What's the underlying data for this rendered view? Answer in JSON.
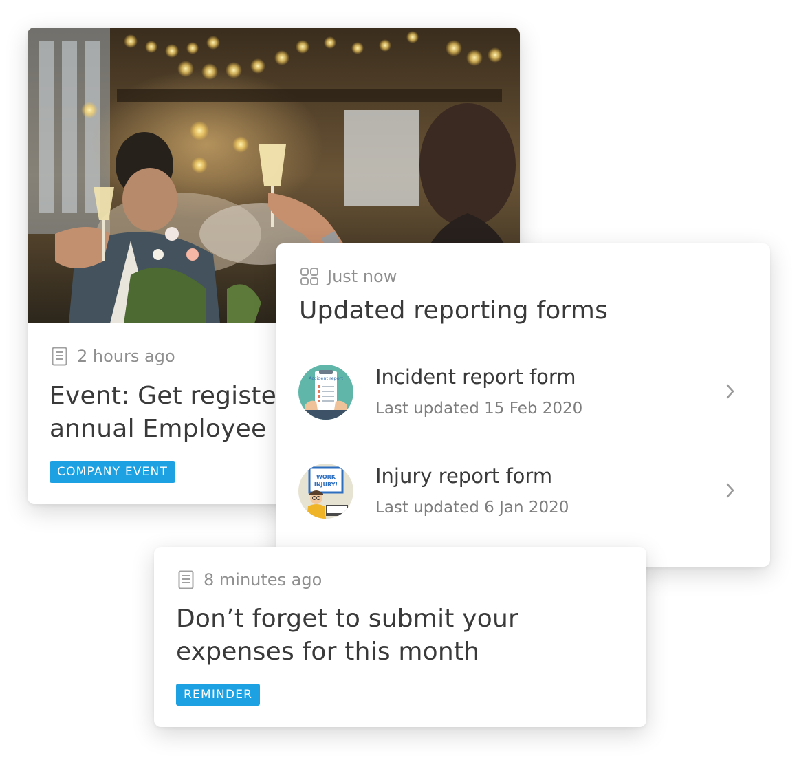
{
  "cards": {
    "event": {
      "timestamp": "2 hours ago",
      "meta_icon": "document-icon",
      "title_line1": "Event: Get registe",
      "title_line2": "annual Employee",
      "tag": "COMPANY EVENT",
      "photo": "celebration-toast-photo"
    },
    "forms": {
      "timestamp": "Just now",
      "meta_icon": "grid-icon",
      "title": "Updated reporting forms",
      "items": [
        {
          "name": "Incident report form",
          "updated": "Last updated 15 Feb 2020",
          "thumb_icon": "incident-report-illustration",
          "thumb_text": "Accident report"
        },
        {
          "name": "Injury report form",
          "updated": "Last updated 6 Jan 2020",
          "thumb_icon": "work-injury-illustration",
          "thumb_text": "WORK INJURY!"
        }
      ]
    },
    "reminder": {
      "timestamp": "8 minutes ago",
      "meta_icon": "document-icon",
      "title_line1": "Don’t forget to submit your",
      "title_line2": "expenses for this month",
      "tag": "REMINDER"
    }
  },
  "colors": {
    "tag_bg": "#1da1e2",
    "text_primary": "#3a3a3a",
    "text_muted": "#8f8f8f",
    "card_bg": "#ffffff"
  }
}
